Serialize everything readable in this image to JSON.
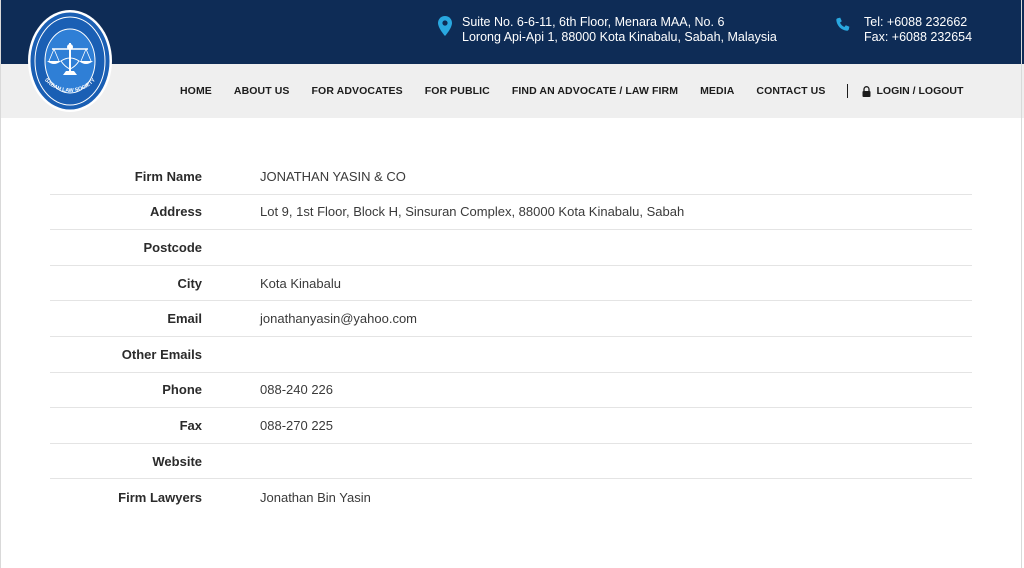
{
  "header": {
    "logo_text": "SABAH LAW SOCIETY",
    "address_line1": "Suite No. 6-6-11, 6th Floor, Menara MAA, No. 6",
    "address_line2": "Lorong Api-Api 1, 88000 Kota Kinabalu, Sabah, Malaysia",
    "tel": "Tel: +6088 232662",
    "fax": "Fax: +6088 232654",
    "location_icon": "map-pin-icon",
    "phone_icon": "phone-icon"
  },
  "nav": {
    "items": [
      "HOME",
      "ABOUT US",
      "FOR ADVOCATES",
      "FOR PUBLIC",
      "FIND AN ADVOCATE / LAW FIRM",
      "MEDIA",
      "CONTACT US"
    ],
    "login": "LOGIN / LOGOUT",
    "login_icon": "lock-icon"
  },
  "firm": {
    "rows": [
      {
        "label": "Firm Name",
        "value": "JONATHAN YASIN & CO"
      },
      {
        "label": "Address",
        "value": "Lot 9, 1st Floor, Block H, Sinsuran Complex, 88000 Kota Kinabalu, Sabah"
      },
      {
        "label": "Postcode",
        "value": ""
      },
      {
        "label": "City",
        "value": "Kota Kinabalu"
      },
      {
        "label": "Email",
        "value": "jonathanyasin@yahoo.com"
      },
      {
        "label": "Other Emails",
        "value": ""
      },
      {
        "label": "Phone",
        "value": "088-240 226"
      },
      {
        "label": "Fax",
        "value": "088-270 225"
      },
      {
        "label": "Website",
        "value": ""
      },
      {
        "label": "Firm Lawyers",
        "value": "Jonathan Bin Yasin"
      }
    ]
  },
  "colors": {
    "header_bg": "#0e2c56",
    "nav_bg": "#efefef",
    "icon_accent": "#29a8e0"
  }
}
